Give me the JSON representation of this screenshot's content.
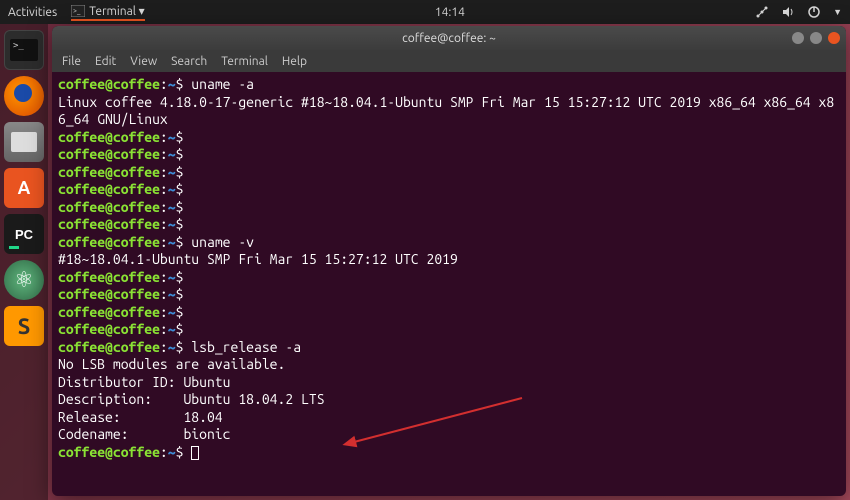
{
  "top_panel": {
    "activities": "Activities",
    "app_label": "Terminal ▾",
    "time": "14:14"
  },
  "launcher": {
    "items": [
      "terminal",
      "firefox",
      "files",
      "software",
      "pycharm",
      "atom",
      "sublime"
    ]
  },
  "window": {
    "title": "coffee@coffee: ~",
    "menu": [
      "File",
      "Edit",
      "View",
      "Search",
      "Terminal",
      "Help"
    ]
  },
  "prompt": {
    "user_host": "coffee@coffee",
    "path": "~",
    "sep": ":",
    "symbol": "$"
  },
  "lines": [
    {
      "type": "cmd",
      "text": "uname -a"
    },
    {
      "type": "out",
      "text": "Linux coffee 4.18.0-17-generic #18~18.04.1-Ubuntu SMP Fri Mar 15 15:27:12 UTC 2019 x86_64 x86_64 x86_64 GNU/Linux"
    },
    {
      "type": "cmd",
      "text": ""
    },
    {
      "type": "cmd",
      "text": ""
    },
    {
      "type": "cmd",
      "text": ""
    },
    {
      "type": "cmd",
      "text": ""
    },
    {
      "type": "cmd",
      "text": ""
    },
    {
      "type": "cmd",
      "text": ""
    },
    {
      "type": "cmd",
      "text": "uname -v"
    },
    {
      "type": "out",
      "text": "#18~18.04.1-Ubuntu SMP Fri Mar 15 15:27:12 UTC 2019"
    },
    {
      "type": "cmd",
      "text": ""
    },
    {
      "type": "cmd",
      "text": ""
    },
    {
      "type": "cmd",
      "text": ""
    },
    {
      "type": "cmd",
      "text": ""
    },
    {
      "type": "cmd",
      "text": "lsb_release -a"
    },
    {
      "type": "out",
      "text": "No LSB modules are available."
    },
    {
      "type": "out",
      "text": "Distributor ID: Ubuntu"
    },
    {
      "type": "out",
      "text": "Description:    Ubuntu 18.04.2 LTS"
    },
    {
      "type": "out",
      "text": "Release:        18.04"
    },
    {
      "type": "out",
      "text": "Codename:       bionic"
    },
    {
      "type": "cmd",
      "text": "",
      "cursor": true
    }
  ],
  "annotation": {
    "arrow_target": "Description line (Ubuntu 18.04.2 LTS)",
    "color": "#d32f2f"
  }
}
